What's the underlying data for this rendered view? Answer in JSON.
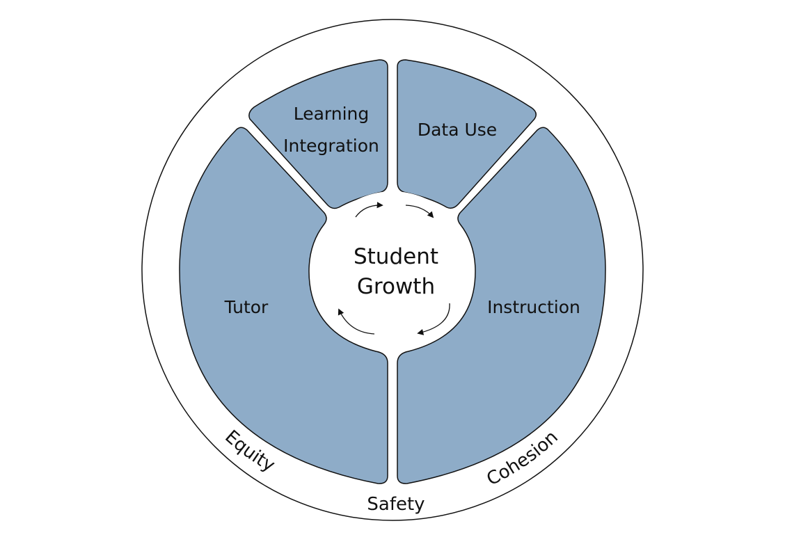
{
  "diagram": {
    "center": {
      "line1": "Student",
      "line2": "Growth"
    },
    "segments": {
      "learning_line1": "Learning",
      "learning_line2": "Integration",
      "data_use": "Data Use",
      "tutor": "Tutor",
      "instruction": "Instruction"
    },
    "ring": {
      "equity": "Equity",
      "safety": "Safety",
      "cohesion": "Cohesion"
    },
    "colors": {
      "segment_fill": "#8eacc8",
      "outline": "#111111",
      "background": "#ffffff"
    }
  }
}
